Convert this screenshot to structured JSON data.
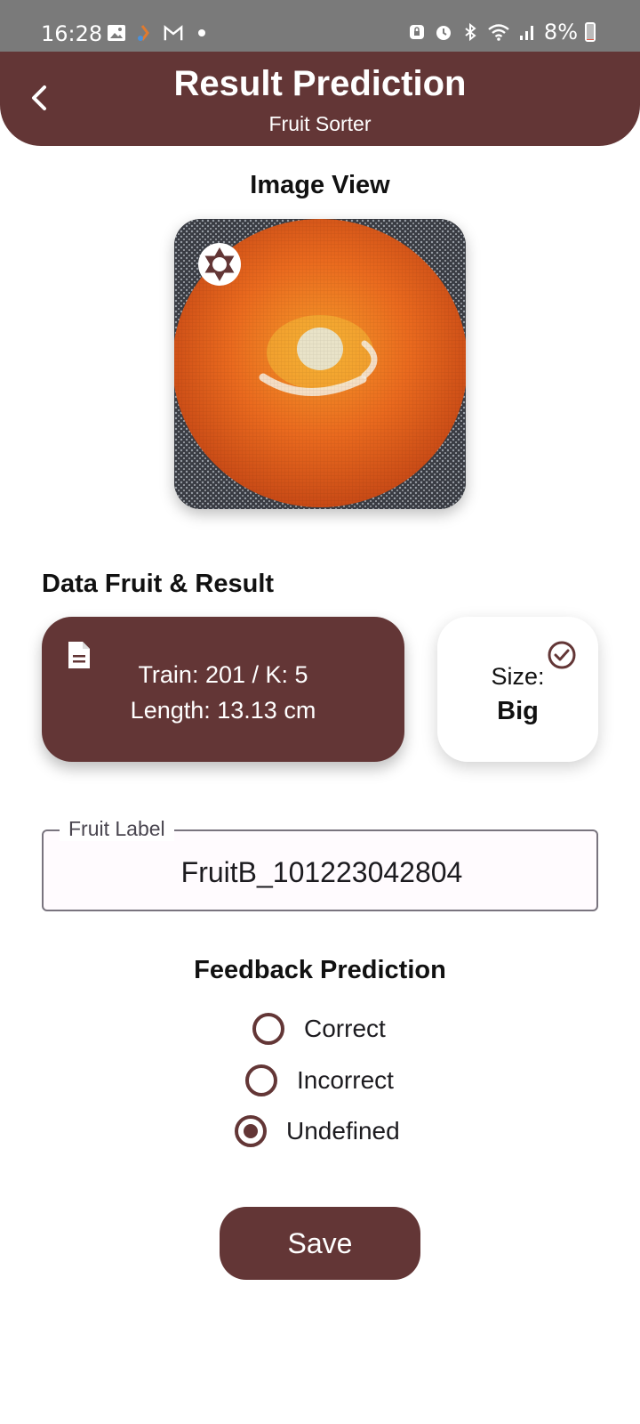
{
  "status_bar": {
    "time": "16:28",
    "battery_text": "8%",
    "battery_level": 0.08,
    "left_icons": [
      "gallery-icon",
      "app-icon",
      "gmail-icon",
      "dot-icon"
    ],
    "right_icons": [
      "lock-icon",
      "alarm-icon",
      "bluetooth-icon",
      "wifi-icon",
      "signal-icon",
      "battery-icon"
    ]
  },
  "app_bar": {
    "title": "Result Prediction",
    "subtitle": "Fruit Sorter",
    "back_icon": "chevron-left-icon"
  },
  "image_section": {
    "title": "Image View",
    "overlay_icon": "camera-shutter-icon"
  },
  "data_section": {
    "title": "Data Fruit & Result",
    "info_card": {
      "icon": "document-icon",
      "line1": "Train: 201 / K: 5",
      "line2": "Length: 13.13 cm"
    },
    "size_card": {
      "icon": "check-circle-icon",
      "label": "Size:",
      "value": "Big"
    }
  },
  "fruit_label_field": {
    "label": "Fruit Label",
    "value": "FruitB_101223042804"
  },
  "feedback": {
    "title": "Feedback Prediction",
    "options": [
      {
        "label": "Correct",
        "selected": false
      },
      {
        "label": "Incorrect",
        "selected": false
      },
      {
        "label": "Undefined",
        "selected": true
      }
    ]
  },
  "save_button": {
    "label": "Save"
  },
  "colors": {
    "primary": "#633636",
    "status_bar": "#7a7a7a",
    "background": "#ffffff"
  }
}
